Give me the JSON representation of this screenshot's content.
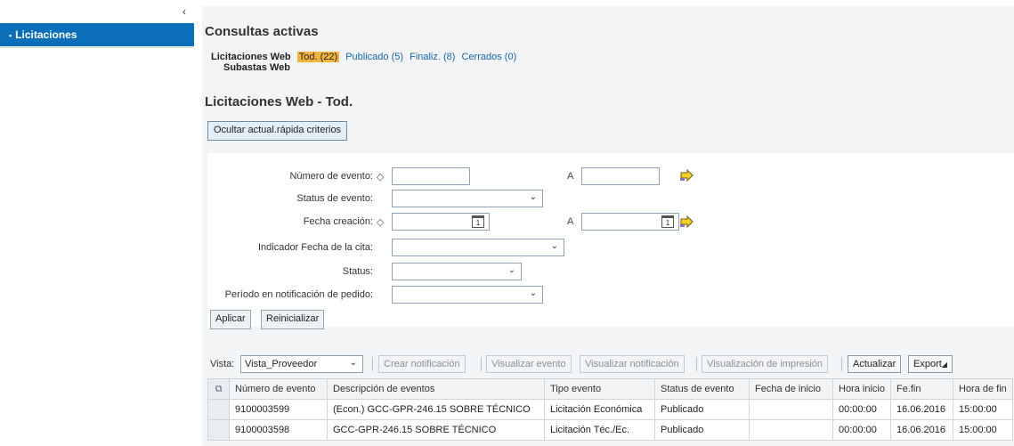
{
  "sidebar": {
    "collapse_glyph": "‹",
    "items": [
      {
        "label": "Licitaciones"
      }
    ]
  },
  "main": {
    "title": "Consultas activas",
    "tabs_label": "Licitaciones Web",
    "tabs": [
      {
        "label": "Tod. (22)",
        "active": true
      },
      {
        "label": "Publicado (5)"
      },
      {
        "label": "Finaliz. (8)"
      },
      {
        "label": "Cerrados (0)"
      }
    ],
    "sub_label": "Subastas Web",
    "section_title": "Licitaciones Web - Tod.",
    "toggle_button": "Ocultar actual.rápida criterios"
  },
  "criteria": {
    "numero_evento": {
      "label": "Número de evento:",
      "value": "",
      "to_label": "A",
      "to_value": ""
    },
    "status_evento": {
      "label": "Status de evento:",
      "value": ""
    },
    "fecha_creacion": {
      "label": "Fecha creación:",
      "value": "",
      "to_label": "A",
      "to_value": ""
    },
    "indicador_fecha": {
      "label": "Indicador Fecha de la cita:",
      "value": ""
    },
    "status": {
      "label": "Status:",
      "value": ""
    },
    "periodo": {
      "label": "Período en notificación de pedido:",
      "value": ""
    },
    "apply_button": "Aplicar",
    "reset_button": "Reinicializar"
  },
  "toolbar": {
    "view_label": "Vista:",
    "view_value": "Vista_Proveedor",
    "buttons": {
      "crear": "Crear notificación",
      "visualizar_evento": "Visualizar evento",
      "visualizar_notif": "Visualizar notificación",
      "impresion": "Visualización de impresión",
      "actualizar": "Actualizar",
      "export": "Export"
    }
  },
  "table": {
    "columns": [
      "Número de evento",
      "Descripción de eventos",
      "Tipo evento",
      "Status de evento",
      "Fecha de inicio",
      "Hora inicio",
      "Fe.fin",
      "Hora de fin"
    ],
    "rows": [
      [
        "9100003599",
        "(Econ.) GCC-GPR-246.15 SOBRE TÉCNICO",
        "Licitación Económica",
        "Publicado",
        "",
        "00:00:00",
        "16.06.2016",
        "15:00:00"
      ],
      [
        "9100003598",
        "GCC-GPR-246.15 SOBRE TÉCNICO",
        "Licitación Téc./Ec.",
        "Publicado",
        "",
        "00:00:00",
        "16.06.2016",
        "15:00:00"
      ]
    ]
  },
  "colors": {
    "nav_active": "#0a6fb8",
    "tab_active": "#f3b33d",
    "link": "#1666b1"
  }
}
